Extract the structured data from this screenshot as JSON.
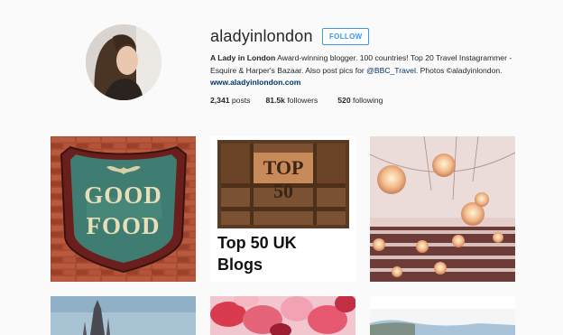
{
  "profile": {
    "username": "aladyinlondon",
    "follow_label": "FOLLOW",
    "bio": {
      "name": "A Lady in London",
      "text": "Award-winning blogger. 100 countries! Top 20 Travel Instagrammer - Esquire & Harper's Bazaar. Also post pics for",
      "mention": "@BBC_Travel",
      "text2": ". Photos ©aladyinlondon.",
      "website": "www.aladyinlondon.com"
    },
    "stats": {
      "posts_count": "2,341",
      "posts_label": "posts",
      "followers_count": "81.5k",
      "followers_label": "followers",
      "following_count": "520",
      "following_label": "following"
    }
  },
  "posts": [
    {
      "sign_line1": "GOOD",
      "sign_line2": "FOOD",
      "icon": "good-food-sign"
    },
    {
      "shelf_text": "TOP 50",
      "caption_line1": "Top 50 UK",
      "caption_line2": "Blogs",
      "icon": "top-50-blog-graphic"
    },
    {
      "icon": "bookshop-pendant-lights"
    },
    {
      "icon": "cathedral-spire"
    },
    {
      "icon": "autumn-leaves"
    },
    {
      "icon": "coastline"
    }
  ],
  "colors": {
    "accent": "#3897f0",
    "link": "#003569",
    "background": "#fafafa"
  }
}
